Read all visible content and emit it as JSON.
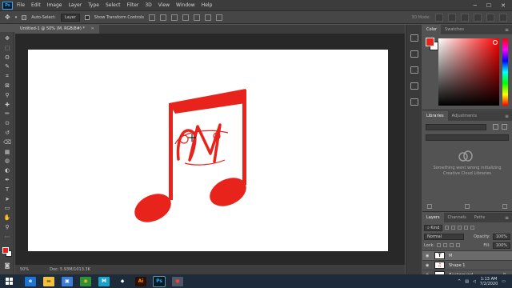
{
  "menubar": {
    "app_icon": "Ps",
    "items": [
      "File",
      "Edit",
      "Image",
      "Layer",
      "Type",
      "Select",
      "Filter",
      "3D",
      "View",
      "Window",
      "Help"
    ],
    "window_controls": [
      "minimize-icon",
      "maximize-icon",
      "close-icon"
    ]
  },
  "options": {
    "auto_select_label": "Auto-Select:",
    "auto_select_checked": true,
    "auto_select_target": "Layer",
    "transform_label": "Show Transform Controls",
    "transform_checked": false,
    "mode_label": "3D Mode:"
  },
  "document": {
    "tab_title": "Untitled-1 @ 50% (M, RGB/8#) *",
    "zoom": "50%",
    "doc_info": "Doc: 5.93M/1013.3K",
    "note_color": "#e8231b"
  },
  "tools": [
    "move-icon",
    "marquee-icon",
    "lasso-icon",
    "quick-select-icon",
    "crop-icon",
    "frame-icon",
    "eyedropper-icon",
    "healing-icon",
    "brush-icon",
    "stamp-icon",
    "history-brush-icon",
    "eraser-icon",
    "gradient-icon",
    "blur-icon",
    "dodge-icon",
    "pen-icon",
    "type-icon",
    "path-select-icon",
    "shape-icon",
    "hand-icon",
    "zoom-icon",
    "more-tools-icon"
  ],
  "colors": {
    "foreground": "#e8231b",
    "background": "#ffffff",
    "accent": "#31a8ff"
  },
  "color_panel": {
    "tabs": [
      "Color",
      "Swatches"
    ]
  },
  "libraries_panel": {
    "tabs": [
      "Libraries",
      "Adjustments"
    ],
    "error_line1": "Something went wrong initializing",
    "error_line2": "Creative Cloud Libraries"
  },
  "layers_panel": {
    "tabs": [
      "Layers",
      "Channels",
      "Paths"
    ],
    "filter_kind": "Kind",
    "blend_mode": "Normal",
    "opacity_label": "Opacity:",
    "opacity_value": "100%",
    "lock_label": "Lock:",
    "fill_label": "Fill:",
    "fill_value": "100%",
    "layers": [
      {
        "name": "M",
        "kind": "type"
      },
      {
        "name": "Shape 1",
        "kind": "shape"
      },
      {
        "name": "Background",
        "kind": "background"
      }
    ]
  },
  "taskbar": {
    "apps": [
      {
        "icon": "edge-icon",
        "label": "e",
        "bg": "#1b74d1",
        "fg": "#ffffff"
      },
      {
        "icon": "file-explorer-icon",
        "label": "▬",
        "bg": "#f0c040",
        "fg": "#8a5a10"
      },
      {
        "icon": "store-icon",
        "label": "▣",
        "bg": "#3b7dd8",
        "fg": "#ffffff"
      },
      {
        "icon": "chrome-icon",
        "label": "◉",
        "bg": "#2f8f3a",
        "fg": "#f4c20d"
      },
      {
        "icon": "corel-icon",
        "label": "M",
        "bg": "#1aa2c9",
        "fg": "#ffffff"
      },
      {
        "icon": "inkscape-icon",
        "label": "◆",
        "bg": "#1d2b3a",
        "fg": "#ffffff"
      },
      {
        "icon": "illustrator-icon",
        "label": "Ai",
        "bg": "#2d0f00",
        "fg": "#ff8a00"
      },
      {
        "icon": "photoshop-icon",
        "label": "Ps",
        "bg": "#001d26",
        "fg": "#31a8ff"
      },
      {
        "icon": "recorder-icon",
        "label": "●",
        "bg": "#4d5966",
        "fg": "#ff3b30"
      }
    ],
    "time": "1:13 AM",
    "date": "7/2/2020"
  }
}
